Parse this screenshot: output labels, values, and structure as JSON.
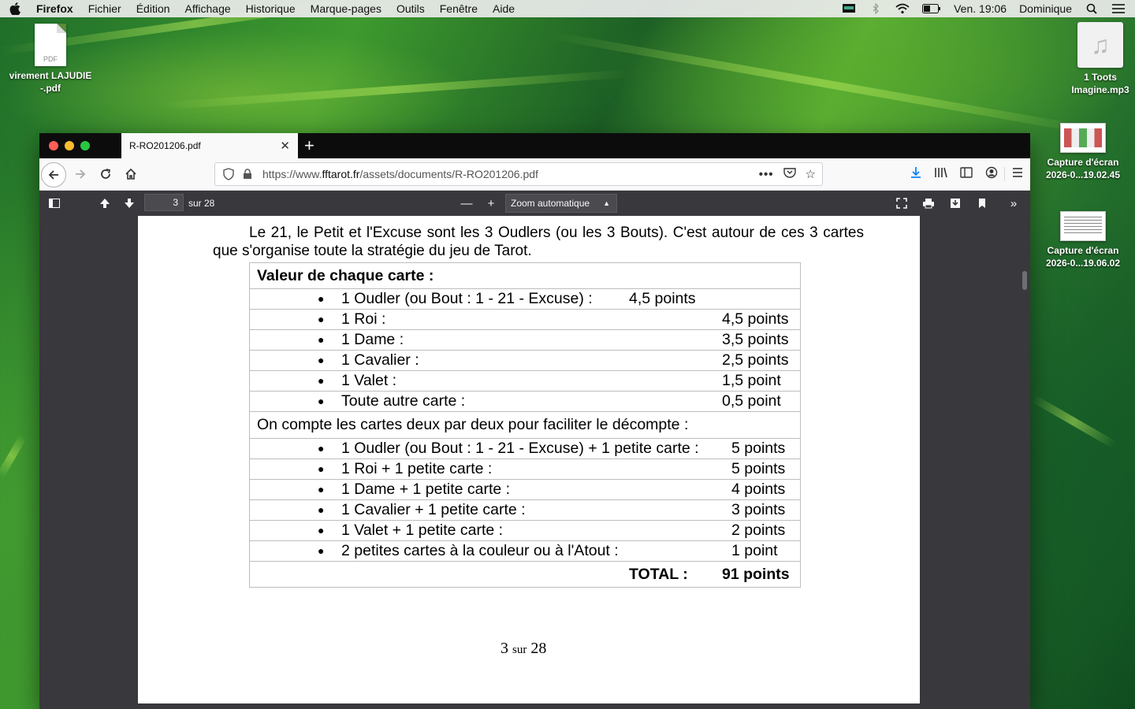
{
  "menubar": {
    "app_name": "Firefox",
    "items": [
      "Fichier",
      "Édition",
      "Affichage",
      "Historique",
      "Marque-pages",
      "Outils",
      "Fenêtre",
      "Aide"
    ],
    "clock": "Ven. 19:06",
    "user": "Dominique"
  },
  "desktop": {
    "icons": [
      {
        "label": "virement LAJUDIE -.pdf",
        "type_tag": "PDF"
      },
      {
        "label": "1 Toots Imagine.mp3"
      },
      {
        "label": "Capture d'écran 2026-0...19.02.45"
      },
      {
        "label": "Capture d'écran 2026-0...19.06.02"
      }
    ]
  },
  "browser": {
    "tab_title": "R-RO201206.pdf",
    "url_prefix": "https://www.",
    "url_domain": "fftarot.fr",
    "url_path": "/assets/documents/R-RO201206.pdf"
  },
  "pdf_toolbar": {
    "page_number": "3",
    "page_count": "sur 28",
    "zoom": "Zoom automatique"
  },
  "document": {
    "intro": "Le 21, le Petit et l'Excuse sont les 3 Oudlers (ou les 3 Bouts). C'est autour de ces 3 cartes que s'organise toute la stratégie du jeu de Tarot.",
    "table_title": "Valeur de chaque carte :",
    "card_values": [
      {
        "label": "1 Oudler (ou Bout : 1 - 21 - Excuse) :",
        "value": "4,5 points"
      },
      {
        "label": "1 Roi :",
        "value": "4,5 points"
      },
      {
        "label": "1 Dame :",
        "value": "3,5 points"
      },
      {
        "label": "1 Cavalier :",
        "value": "2,5 points"
      },
      {
        "label": "1 Valet :",
        "value": "1,5 point"
      },
      {
        "label": "Toute autre carte :",
        "value": "0,5 point"
      }
    ],
    "count_heading": "On compte les cartes deux par deux pour faciliter le décompte :",
    "pair_values": [
      {
        "label": "1 Oudler (ou Bout : 1 - 21 - Excuse) + 1 petite carte :",
        "value": "5 points"
      },
      {
        "label": "1 Roi + 1 petite carte :",
        "value": "5 points"
      },
      {
        "label": "1 Dame + 1 petite carte :",
        "value": "4 points"
      },
      {
        "label": "1 Cavalier + 1 petite carte :",
        "value": "3 points"
      },
      {
        "label": "1 Valet + 1 petite carte :",
        "value": "2 points"
      },
      {
        "label": "2 petites cartes à la couleur ou à l'Atout :",
        "value": "1 point"
      }
    ],
    "total_label": "TOTAL :",
    "total_value": "91 points",
    "footer_page": "3",
    "footer_sur": "sur",
    "footer_total": "28"
  }
}
